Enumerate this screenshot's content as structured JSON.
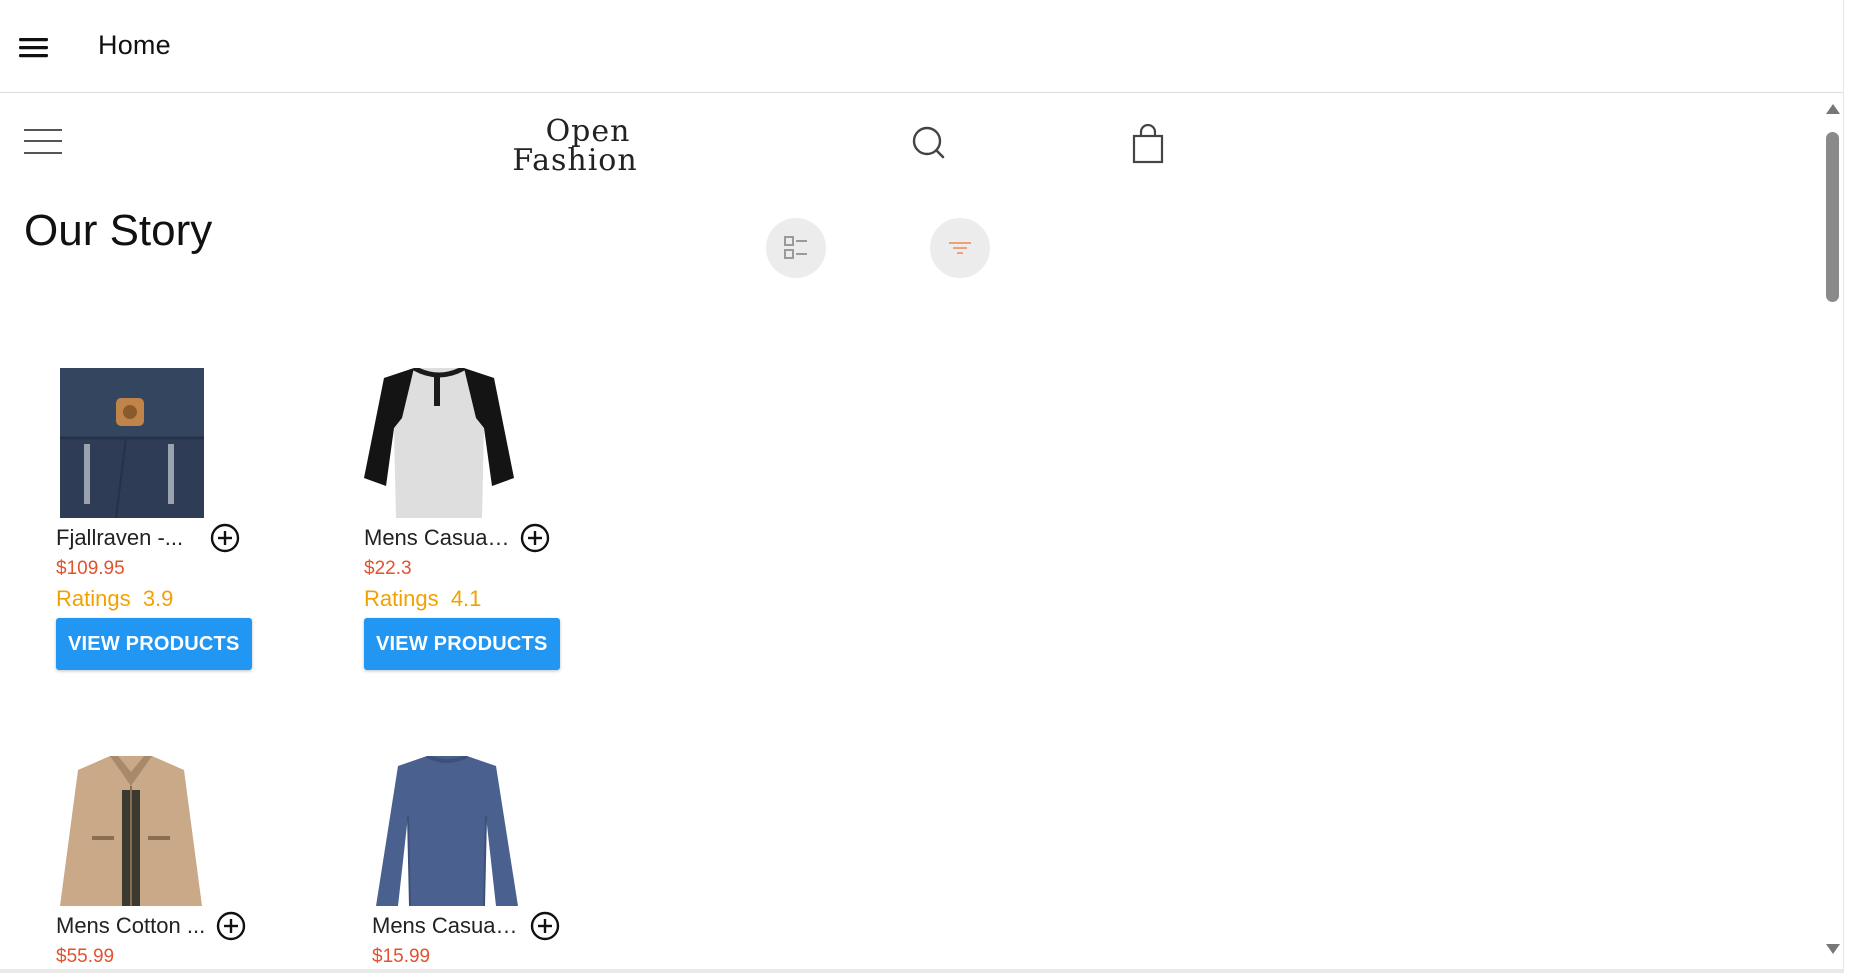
{
  "appbar": {
    "menu_icon": "hamburger-menu-icon",
    "title": "Home"
  },
  "shop_header": {
    "menu_icon": "menu-lines-icon",
    "logo_line1": "Open",
    "logo_line2": "Fashion",
    "search_icon": "search-icon",
    "cart_icon": "shopping-bag-icon"
  },
  "page": {
    "title": "Our Story",
    "view_toggle_icon": "list-view-icon",
    "filter_icon": "filter-icon"
  },
  "colors": {
    "price": "#e2522e",
    "rating": "#f2a100",
    "button": "#2196f3",
    "round_button_bg": "#ececec",
    "filter_icon": "#f0a07a"
  },
  "products": [
    {
      "name": "Fjallraven -...",
      "price": "$109.95",
      "rating_label": "Ratings  3.9",
      "button_label": "VIEW PRODUCTS",
      "image_icon": "backpack-image"
    },
    {
      "name": "Mens Casual ...",
      "price": "$22.3",
      "rating_label": "Ratings  4.1",
      "button_label": "VIEW PRODUCTS",
      "image_icon": "raglan-tshirt-image"
    },
    {
      "name": "Mens Cotton ...",
      "price": "$55.99",
      "image_icon": "cotton-jacket-image"
    },
    {
      "name": "Mens Casual ...",
      "price": "$15.99",
      "image_icon": "slim-fit-longsleeve-image"
    }
  ]
}
